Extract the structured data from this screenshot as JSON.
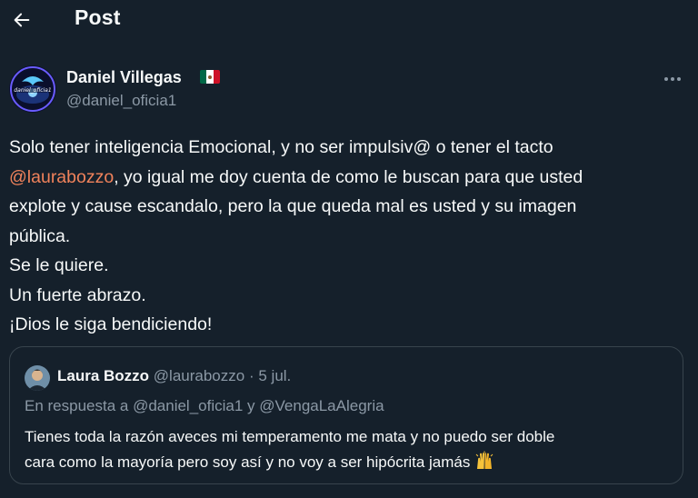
{
  "header": {
    "title": "Post"
  },
  "colors": {
    "background": "#15202b",
    "text": "#f7f9f9",
    "muted": "#8b98a5",
    "mention": "#f0825b",
    "border": "#38444d"
  },
  "author": {
    "name": "Daniel Villegas",
    "handle": "@daniel_oficia1",
    "flag_icon": "mexico-flag-icon",
    "avatar_text": "daniel_oficia1"
  },
  "post": {
    "line1": "Solo tener inteligencia Emocional, y no ser impulsiv@ o tener el tacto",
    "mention": "@laurabozzo",
    "line2_rest": ", yo igual me doy cuenta de como le buscan para que usted",
    "line3": "explote y cause escandalo, pero la que queda mal es usted y su imagen",
    "line4": "pública.",
    "line5": "Se le quiere.",
    "line6": "Un fuerte abrazo.",
    "line7": "¡Dios le siga bendiciendo!"
  },
  "quote": {
    "name": "Laura Bozzo",
    "handle": "@laurabozzo",
    "separator": "·",
    "date": "5 jul.",
    "reply_to": "En respuesta a @daniel_oficia1 y @VengaLaAlegria",
    "text_line1": "Tienes toda la razón aveces mi temperamento me mata y no puedo ser doble",
    "text_line2": "cara como la mayoría pero soy así y no voy a ser hipócrita jamás",
    "emoji_icon": "raising-hands-icon"
  }
}
